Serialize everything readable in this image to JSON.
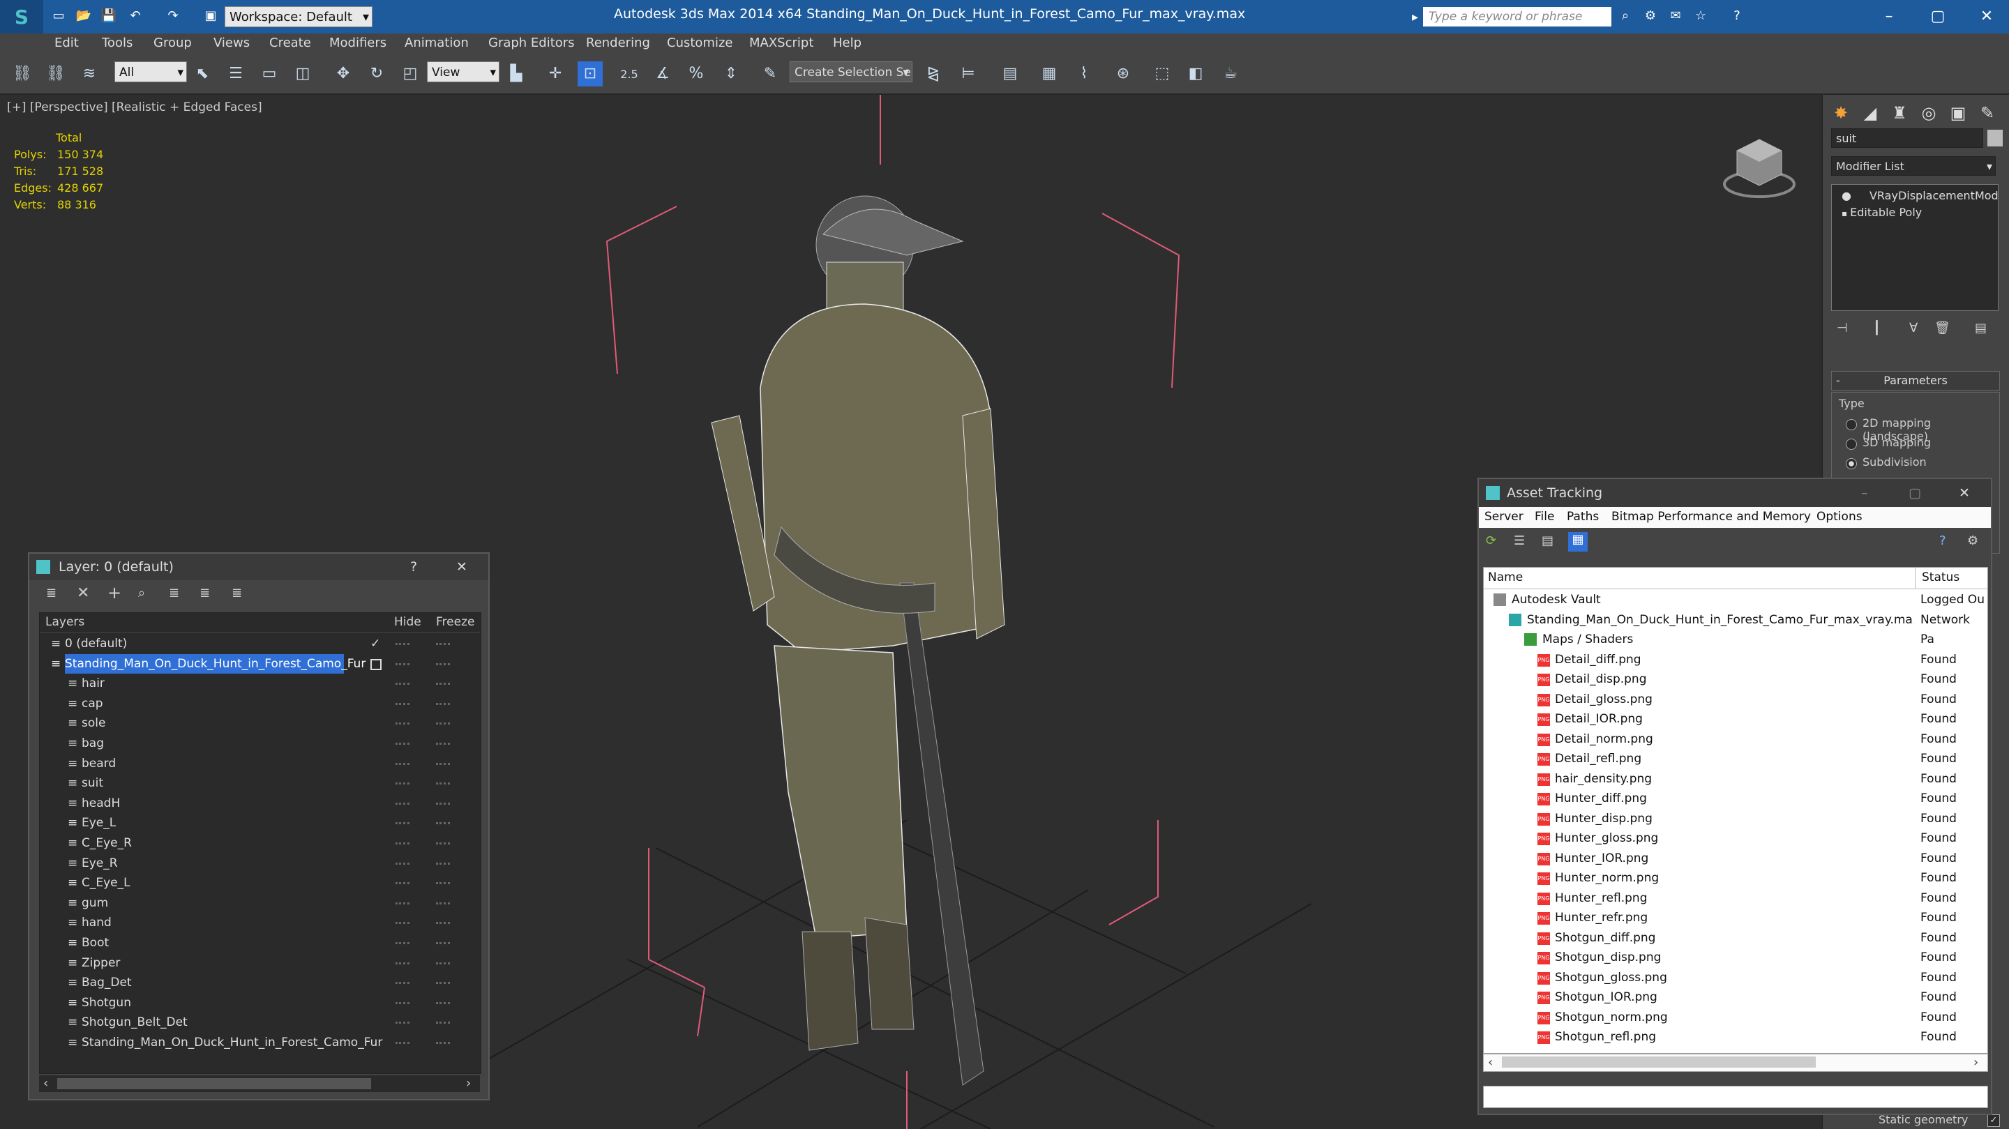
{
  "titlebar": {
    "workspace": "Workspace: Default",
    "app_title": "Autodesk 3ds Max  2014 x64      Standing_Man_On_Duck_Hunt_in_Forest_Camo_Fur_max_vray.max",
    "search_placeholder": "Type a keyword or phrase"
  },
  "menu": [
    "Edit",
    "Tools",
    "Group",
    "Views",
    "Create",
    "Modifiers",
    "Animation",
    "Graph Editors",
    "Rendering",
    "Customize",
    "MAXScript",
    "Help"
  ],
  "toolbar": {
    "selection_filter": "All",
    "reference_coord": "View",
    "named_selection_placeholder": "Create Selection Se",
    "snap_label": "2.5"
  },
  "viewport": {
    "label": "[+] [Perspective] [Realistic + Edged Faces]",
    "stats": {
      "total_label": "Total",
      "rows": [
        {
          "label": "Polys:",
          "value": "150 374"
        },
        {
          "label": "Tris:",
          "value": "171 528"
        },
        {
          "label": "Edges:",
          "value": "428 667"
        },
        {
          "label": "Verts:",
          "value": "88 316"
        }
      ]
    }
  },
  "command_panel": {
    "object_name": "suit",
    "modifier_list": "Modifier List",
    "stack": [
      "VRayDisplacementMod",
      "Editable Poly"
    ],
    "parameters_title": "Parameters",
    "type_label": "Type",
    "type_options": [
      "2D mapping (landscape)",
      "3D mapping",
      "Subdivision"
    ],
    "selected_type": 2,
    "static_geometry": "Static geometry"
  },
  "layer_window": {
    "title": "Layer: 0 (default)",
    "col_layers": "Layers",
    "col_hide": "Hide",
    "col_freeze": "Freeze",
    "rows": [
      {
        "name": "0 (default)",
        "indent": 1
      },
      {
        "name": "Standing_Man_On_Duck_Hunt_in_Forest_Camo_Fur",
        "indent": 1,
        "selected": true
      },
      {
        "name": "hair",
        "indent": 2
      },
      {
        "name": "cap",
        "indent": 2
      },
      {
        "name": "sole",
        "indent": 2
      },
      {
        "name": "bag",
        "indent": 2
      },
      {
        "name": "beard",
        "indent": 2
      },
      {
        "name": "suit",
        "indent": 2
      },
      {
        "name": "headH",
        "indent": 2
      },
      {
        "name": "Eye_L",
        "indent": 2
      },
      {
        "name": "C_Eye_R",
        "indent": 2
      },
      {
        "name": "Eye_R",
        "indent": 2
      },
      {
        "name": "C_Eye_L",
        "indent": 2
      },
      {
        "name": "gum",
        "indent": 2
      },
      {
        "name": "hand",
        "indent": 2
      },
      {
        "name": "Boot",
        "indent": 2
      },
      {
        "name": "Zipper",
        "indent": 2
      },
      {
        "name": "Bag_Det",
        "indent": 2
      },
      {
        "name": "Shotgun",
        "indent": 2
      },
      {
        "name": "Shotgun_Belt_Det",
        "indent": 2
      },
      {
        "name": "Standing_Man_On_Duck_Hunt_in_Forest_Camo_Fur",
        "indent": 2
      }
    ]
  },
  "asset_window": {
    "title": "Asset Tracking",
    "menu": [
      "Server",
      "File",
      "Paths",
      "Bitmap Performance and Memory",
      "Options"
    ],
    "col_name": "Name",
    "col_status": "Status",
    "rows": [
      {
        "name": "Autodesk Vault",
        "status": "Logged Ou",
        "indent": 1,
        "kind": "vault"
      },
      {
        "name": "Standing_Man_On_Duck_Hunt_in_Forest_Camo_Fur_max_vray.max",
        "status": "Network Pa",
        "indent": 2,
        "kind": "max"
      },
      {
        "name": "Maps / Shaders",
        "status": "",
        "indent": 3,
        "kind": "folder"
      },
      {
        "name": "Detail_diff.png",
        "status": "Found",
        "indent": 4,
        "kind": "png"
      },
      {
        "name": "Detail_disp.png",
        "status": "Found",
        "indent": 4,
        "kind": "png"
      },
      {
        "name": "Detail_gloss.png",
        "status": "Found",
        "indent": 4,
        "kind": "png"
      },
      {
        "name": "Detail_IOR.png",
        "status": "Found",
        "indent": 4,
        "kind": "png"
      },
      {
        "name": "Detail_norm.png",
        "status": "Found",
        "indent": 4,
        "kind": "png"
      },
      {
        "name": "Detail_refl.png",
        "status": "Found",
        "indent": 4,
        "kind": "png"
      },
      {
        "name": "hair_density.png",
        "status": "Found",
        "indent": 4,
        "kind": "png"
      },
      {
        "name": "Hunter_diff.png",
        "status": "Found",
        "indent": 4,
        "kind": "png"
      },
      {
        "name": "Hunter_disp.png",
        "status": "Found",
        "indent": 4,
        "kind": "png"
      },
      {
        "name": "Hunter_gloss.png",
        "status": "Found",
        "indent": 4,
        "kind": "png"
      },
      {
        "name": "Hunter_IOR.png",
        "status": "Found",
        "indent": 4,
        "kind": "png"
      },
      {
        "name": "Hunter_norm.png",
        "status": "Found",
        "indent": 4,
        "kind": "png"
      },
      {
        "name": "Hunter_refl.png",
        "status": "Found",
        "indent": 4,
        "kind": "png"
      },
      {
        "name": "Hunter_refr.png",
        "status": "Found",
        "indent": 4,
        "kind": "png"
      },
      {
        "name": "Shotgun_diff.png",
        "status": "Found",
        "indent": 4,
        "kind": "png"
      },
      {
        "name": "Shotgun_disp.png",
        "status": "Found",
        "indent": 4,
        "kind": "png"
      },
      {
        "name": "Shotgun_gloss.png",
        "status": "Found",
        "indent": 4,
        "kind": "png"
      },
      {
        "name": "Shotgun_IOR.png",
        "status": "Found",
        "indent": 4,
        "kind": "png"
      },
      {
        "name": "Shotgun_norm.png",
        "status": "Found",
        "indent": 4,
        "kind": "png"
      },
      {
        "name": "Shotgun_refl.png",
        "status": "Found",
        "indent": 4,
        "kind": "png"
      }
    ]
  },
  "colors": {
    "title_bar": "#1e5b9c",
    "panel": "#444444",
    "viewport": "#2e2e2e",
    "stats": "#e3d300",
    "selection": "#2f6fd6",
    "gizmo": "#e05a7a"
  }
}
